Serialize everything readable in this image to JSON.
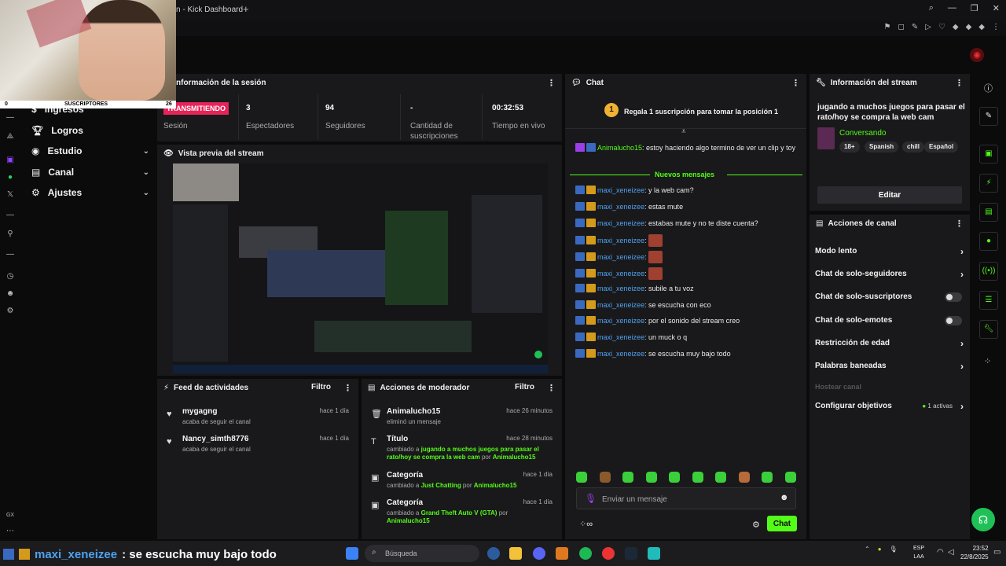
{
  "browser": {
    "tab_title": "n - Kick Dashboard",
    "new_tab": "+",
    "controls": [
      "⌕",
      "—",
      "❐",
      "✕"
    ],
    "extensions": [
      "⚑",
      "◻",
      "✎",
      "▷",
      "♡",
      "◆",
      "◆",
      "◆",
      "⋮"
    ]
  },
  "overlay": {
    "subs_count_left": "0",
    "subs_label": "SUSCRIPTORES",
    "subs_count_right": "26"
  },
  "nav": {
    "items": [
      {
        "label": "Ingresos",
        "chevron": ""
      },
      {
        "label": "Logros",
        "chevron": ""
      },
      {
        "label": "Estudio",
        "chevron": "⌄"
      },
      {
        "label": "Canal",
        "chevron": "⌄"
      },
      {
        "label": "Ajustes",
        "chevron": "⌄"
      }
    ]
  },
  "session": {
    "title": "nformación de la sesión",
    "live_badge": "TRANSMITIENDO",
    "live_label": "Sesión",
    "stats": [
      {
        "value": "3",
        "label": "Espectadores"
      },
      {
        "value": "94",
        "label": "Seguidores"
      },
      {
        "value": "-",
        "label": "Cantidad de suscripciones"
      },
      {
        "value": "00:32:53",
        "label": "Tiempo en vivo"
      }
    ]
  },
  "preview": {
    "title": "Vista previa del stream"
  },
  "feed": {
    "title": "Feed de actividades",
    "filter": "Filtro",
    "items": [
      {
        "name": "mygagng",
        "sub": "acaba de seguir el canal",
        "time": "hace 1 día"
      },
      {
        "name": "Nancy_simth8776",
        "sub": "acaba de seguir el canal",
        "time": "hace 1 día"
      }
    ]
  },
  "modactions": {
    "title": "Acciones de moderador",
    "filter": "Filtro",
    "items": [
      {
        "name": "Animalucho15",
        "time": "hace 26 minutos",
        "sub": "eliminó un mensaje"
      },
      {
        "name": "Título",
        "time": "hace 28 minutos",
        "sub_pre": "cambiado a ",
        "sub_hl": "jugando a muchos juegos para pasar el rato/hoy se compra la web cam",
        "sub_mid": " por ",
        "sub_user": "Animalucho15"
      },
      {
        "name": "Categoría",
        "time": "hace 1 día",
        "sub_pre": "cambiado a ",
        "sub_hl": "Just Chatting",
        "sub_mid": " por ",
        "sub_user": "Animalucho15"
      },
      {
        "name": "Categoría",
        "time": "hace 1 día",
        "sub_pre": "cambiado a ",
        "sub_hl": "Grand Theft Auto V (GTA)",
        "sub_mid": " por ",
        "sub_user": "Animalucho15"
      }
    ]
  },
  "chat": {
    "title": "Chat",
    "pinned_position": "1",
    "pinned_text": "Regala 1 suscripción para tomar la posición 1",
    "first_msg_user": "Animalucho15",
    "first_msg_text": ": estoy haciendo algo termino de ver un clip y toy",
    "new_messages": "Nuevos mensajes",
    "messages": [
      {
        "user": "maxi_xeneizee",
        "text": ": y la web cam?"
      },
      {
        "user": "maxi_xeneizee",
        "text": ": estas mute"
      },
      {
        "user": "maxi_xeneizee",
        "text": ": estabas mute y no te diste cuenta?"
      },
      {
        "user": "maxi_xeneizee",
        "text": ":"
      },
      {
        "user": "maxi_xeneizee",
        "text": ":"
      },
      {
        "user": "maxi_xeneizee",
        "text": ":"
      },
      {
        "user": "maxi_xeneizee",
        "text": ": subile a tu voz"
      },
      {
        "user": "maxi_xeneizee",
        "text": ": se escucha con eco"
      },
      {
        "user": "maxi_xeneizee",
        "text": ": por el sonido del stream creo"
      },
      {
        "user": "maxi_xeneizee",
        "text": ": un muck o q"
      },
      {
        "user": "maxi_xeneizee",
        "text": ": se escucha muy bajo todo"
      }
    ],
    "input_placeholder": "Enviar un mensaje",
    "send_label": "Chat"
  },
  "streaminfo": {
    "title": "Información del stream",
    "stream_title": "jugando a muchos juegos para pasar el rato/hoy se compra la web cam",
    "category": "Conversando",
    "tags": [
      "18+",
      "Spanish",
      "chill",
      "Español"
    ],
    "edit_label": "Editar"
  },
  "channel_actions": {
    "title": "Acciones de canal",
    "items": [
      {
        "label": "Modo lento",
        "control": "arrow"
      },
      {
        "label": "Chat de solo-seguidores",
        "control": "arrow"
      },
      {
        "label": "Chat de solo-suscriptores",
        "control": "toggle"
      },
      {
        "label": "Chat de solo-emotes",
        "control": "toggle"
      },
      {
        "label": "Restricción de edad",
        "control": "arrow"
      },
      {
        "label": "Palabras baneadas",
        "control": "arrow"
      },
      {
        "label": "Hostear canal",
        "control": "disabled"
      },
      {
        "label": "Configurar objetivos",
        "control": "arrow",
        "extra": "1 activas"
      }
    ]
  },
  "ticker": {
    "user": "maxi_xeneizee",
    "text": ": se escucha muy bajo todo"
  },
  "taskbar": {
    "search_placeholder": "Búsqueda",
    "lang_top": "ESP",
    "lang_bottom": "LAA",
    "time": "23:52",
    "date": "22/8/2025"
  },
  "colors": {
    "accent": "#53fc18",
    "live": "#e5245a",
    "username": "#4fa2f0"
  }
}
